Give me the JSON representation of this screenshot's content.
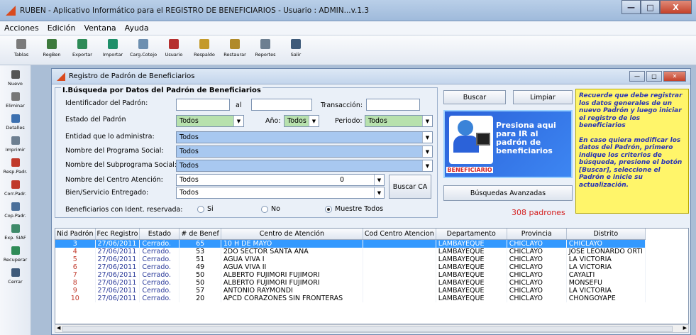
{
  "window": {
    "title": "RUBEN - Aplicativo Informático para el REGISTRO DE BENEFICIARIOS    - Usuario : ADMIN...v.1.3",
    "min": "—",
    "max": "□",
    "close": "X"
  },
  "menu": [
    "Acciones",
    "Edición",
    "Ventana",
    "Ayuda"
  ],
  "toolbar": [
    {
      "label": "Tablas",
      "icon": "tables-icon",
      "color": "#7b7b7b"
    },
    {
      "label": "RegBen",
      "icon": "register-icon",
      "color": "#3d7a3d"
    },
    {
      "label": "Exportar",
      "icon": "export-icon",
      "color": "#2e8b57"
    },
    {
      "label": "Importar",
      "icon": "import-icon",
      "color": "#1f8f6a"
    },
    {
      "label": "Carg.Cotejo",
      "icon": "cotejo-icon",
      "color": "#6d8fb0"
    },
    {
      "label": "Usuario",
      "icon": "user-icon",
      "color": "#b5302f"
    },
    {
      "label": "Respaldo",
      "icon": "backup-icon",
      "color": "#c49a2c"
    },
    {
      "label": "Restaurar",
      "icon": "restore-icon",
      "color": "#b08a2a"
    },
    {
      "label": "Reportes",
      "icon": "reports-icon",
      "color": "#6d7f91"
    },
    {
      "label": "Salir",
      "icon": "exit-icon",
      "color": "#3e5a7a"
    }
  ],
  "sidebar": [
    {
      "label": "Nuevo",
      "icon": "new-icon",
      "color": "#555555"
    },
    {
      "label": "Eliminar",
      "icon": "delete-icon",
      "color": "#777777"
    },
    {
      "label": "Detalles",
      "icon": "details-icon",
      "color": "#3c70b0"
    },
    {
      "label": "Imprimir",
      "icon": "print-icon",
      "color": "#6d7f91"
    },
    {
      "label": "Resp.Padr.",
      "icon": "arrow-left-icon",
      "color": "#c0392b"
    },
    {
      "label": "Corr.Padr.",
      "icon": "arrow-right-icon",
      "color": "#c0392b"
    },
    {
      "label": "Cop.Padr.",
      "icon": "copy-icon",
      "color": "#4a6f9a"
    },
    {
      "label": "Exp. SIAF",
      "icon": "export-siaf-icon",
      "color": "#3e8a6a"
    },
    {
      "label": "Recuperar",
      "icon": "recover-icon",
      "color": "#2e8b57"
    },
    {
      "label": "Cerrar",
      "icon": "close-form-icon",
      "color": "#3e5a7a"
    }
  ],
  "form": {
    "title": "Registro de Padrón de Beneficiarios",
    "group_title": "I.Búsqueda por Datos del Padrón de Beneficiarios",
    "id_label": "Identificador del Padrón:",
    "al_label": "al",
    "transaccion_label": "Transacción:",
    "estado_label": "Estado del Padrón",
    "estado_value": "Todos",
    "anio_label": "Año:",
    "anio_value": "Todos",
    "periodo_label": "Periodo:",
    "periodo_value": "Todos",
    "entidad_label": "Entidad que lo administra:",
    "entidad_value": "Todos",
    "programa_label": "Nombre del Programa Social:",
    "programa_value": "Todos",
    "subprograma_label": "Nombre del Subprograma Social:",
    "subprograma_value": "Todos",
    "centro_label": "Nombre del Centro Atención:",
    "centro_value": "Todos",
    "centro_num": "0",
    "bien_label": "Bien/Servicio Entregado:",
    "bien_value": "Todos",
    "buscar_ca": "Buscar CA",
    "reservada_label": "Beneficiarios con Ident. reservada:",
    "radio_si": "Si",
    "radio_no": "No",
    "radio_todos": "Muestre Todos",
    "buscar": "Buscar",
    "limpiar": "Limpiar",
    "busquedas_avanzadas": "Búsquedas Avanzadas",
    "count": "308 padrones"
  },
  "banner": {
    "text": "Presiona aqui para IR al padrón de beneficiarios",
    "caption": "BENEFICIARIO"
  },
  "note": {
    "p1": "Recuerde que debe registrar los datos generales de un nuevo Padrón y luego iniciar el registro de los beneficiarios",
    "p2": "En caso quiera modificar los datos del Padrón, primero indique los criterios de búsqueda, presione el botón [Buscar], seleccione el Padrón e inicie su actualización."
  },
  "table": {
    "columns": [
      "Nid Padrón",
      "Fec Registro",
      "Estado",
      "# de Benef",
      "Centro de Atención",
      "Cod Centro Atencion",
      "Departamento",
      "Provincia",
      "Distrito"
    ],
    "rows": [
      [
        "3",
        "27/06/2011",
        "Cerrado.",
        "65",
        "10 H DE MAYO",
        "",
        "LAMBAYEQUE",
        "CHICLAYO",
        "CHICLAYO"
      ],
      [
        "4",
        "27/06/2011",
        "Cerrado.",
        "53",
        "2DO SECTOR SANTA ANA",
        "",
        "LAMBAYEQUE",
        "CHICLAYO",
        "JOSE LEONARDO ORTI"
      ],
      [
        "5",
        "27/06/2011",
        "Cerrado.",
        "51",
        "AGUA VIVA I",
        "",
        "LAMBAYEQUE",
        "CHICLAYO",
        "LA VICTORIA"
      ],
      [
        "6",
        "27/06/2011",
        "Cerrado.",
        "49",
        "AGUA VIVA II",
        "",
        "LAMBAYEQUE",
        "CHICLAYO",
        "LA VICTORIA"
      ],
      [
        "7",
        "27/06/2011",
        "Cerrado.",
        "50",
        "ALBERTO FUJIMORI FUJIMORI",
        "",
        "LAMBAYEQUE",
        "CHICLAYO",
        "CAYALTI"
      ],
      [
        "8",
        "27/06/2011",
        "Cerrado.",
        "50",
        "ALBERTO FUJIMORI FUJIMORI",
        "",
        "LAMBAYEQUE",
        "CHICLAYO",
        "MONSEFU"
      ],
      [
        "9",
        "27/06/2011",
        "Cerrado.",
        "57",
        "ANTONIO RAYMONDI",
        "",
        "LAMBAYEQUE",
        "CHICLAYO",
        "LA VICTORIA"
      ],
      [
        "10",
        "27/06/2011",
        "Cerrado.",
        "20",
        "APCD CORAZONES SIN FRONTERAS",
        "",
        "LAMBAYEQUE",
        "CHICLAYO",
        "CHONGOYAPE"
      ]
    ]
  }
}
